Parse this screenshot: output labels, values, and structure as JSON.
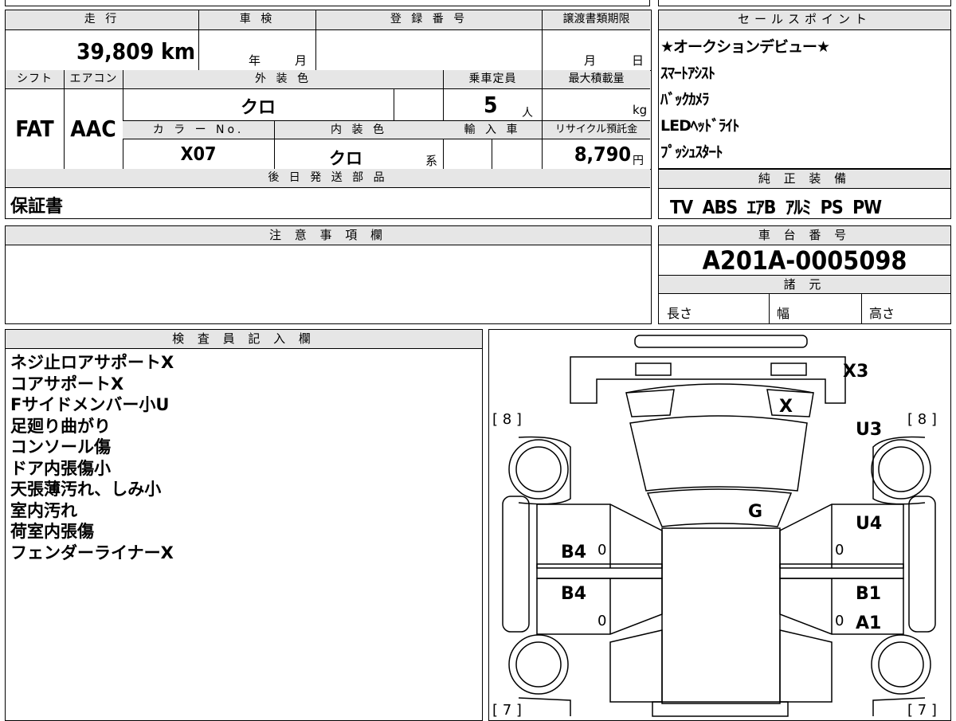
{
  "info": {
    "mileage_label": "走 行",
    "mileage_value": "39,809 km",
    "inspection_label": "車 検",
    "inspection_year": "年",
    "inspection_month": "月",
    "registration_label": "登 録 番 号",
    "transfer_label": "譲渡書類期限",
    "transfer_month": "月",
    "transfer_day": "日",
    "shift_label": "シフト",
    "shift_value": "FAT",
    "ac_label": "エアコン",
    "ac_value": "AAC",
    "exterior_label": "外 装 色",
    "exterior_value": "クロ",
    "capacity_label": "乗車定員",
    "capacity_value": "5",
    "capacity_unit": "人",
    "maxload_label": "最大積載量",
    "maxload_unit": "kg",
    "color_no_label": "カ ラ ー No.",
    "color_no_value": "X07",
    "interior_label": "内 装 色",
    "interior_value": "クロ",
    "interior_unit": "系",
    "import_label": "輸 入 車",
    "recycle_label": "リサイクル預託金",
    "recycle_value": "8,790",
    "recycle_unit": "円",
    "later_parts_label": "後 日 発 送 部 品",
    "later_parts_value": "保証書"
  },
  "sales_points": {
    "label": "セールスポイント",
    "items": [
      "★オークションデビュー★",
      "ｽﾏｰﾄｱｼｽﾄ",
      "ﾊﾞｯｸｶﾒﾗ",
      "LEDﾍｯﾄﾞﾗｲﾄ",
      "ﾌﾟｯｼｭｽﾀｰﾄ"
    ]
  },
  "equipment": {
    "label": "純 正 装 備",
    "value": "TV  ABS  ｴｱB  ｱﾙﾐ  PS  PW"
  },
  "notes": {
    "label": "注 意 事 項 欄"
  },
  "chassis": {
    "label": "車 台 番 号",
    "value": "A201A-0005098"
  },
  "specs": {
    "label": "諸 元",
    "length_label": "長さ",
    "width_label": "幅",
    "height_label": "高さ"
  },
  "inspector": {
    "label": "検 査 員 記 入 欄",
    "lines": [
      "ネジ止ロアサポートX",
      "コアサポートX",
      "Fサイドメンバー小U",
      "足廻り曲がり",
      "コンソール傷",
      "ドア内張傷小",
      "天張薄汚れ、しみ小",
      "室内汚れ",
      "荷室内張傷",
      "フェンダーライナーX"
    ]
  },
  "diagram": {
    "tl_bracket": "[ 8 ]",
    "tr_bracket": "[ 8 ]",
    "bl_bracket": "[ 7 ]",
    "br_bracket": "[ 7 ]",
    "x3": "X3",
    "x": "X",
    "u3": "U3",
    "g": "G",
    "u4": "U4",
    "b4_upper": "B4",
    "b4_lower": "B4",
    "b1": "B1",
    "a1": "A1",
    "zero": "0"
  }
}
